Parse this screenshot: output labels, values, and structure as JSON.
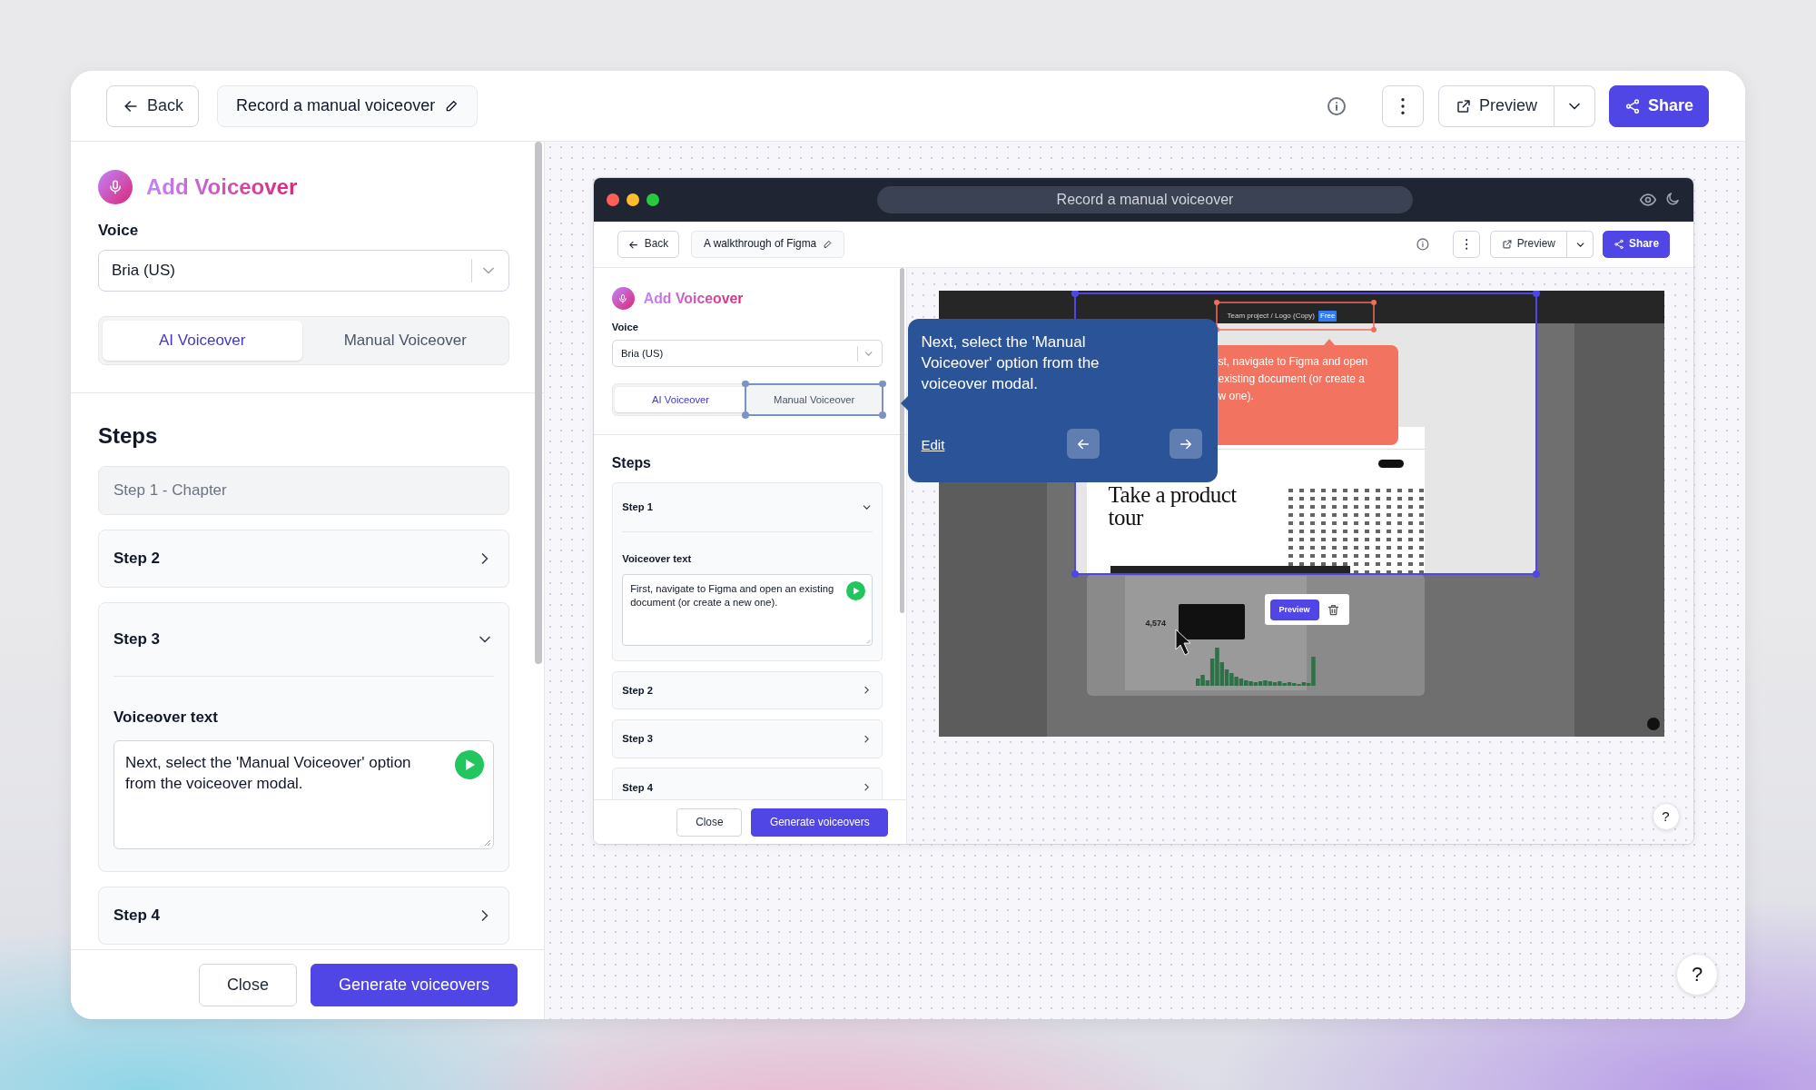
{
  "topbar": {
    "back": "Back",
    "title": "Record a manual voiceover",
    "preview": "Preview",
    "share": "Share"
  },
  "panel": {
    "heading": "Add Voiceover",
    "voice_label": "Voice",
    "voice_value": "Bria (US)",
    "modes": [
      {
        "label": "AI Voiceover",
        "selected": true,
        "highlighted": false
      },
      {
        "label": "Manual Voiceover",
        "selected": false,
        "highlighted": false
      }
    ],
    "steps_heading": "Steps",
    "steps": [
      {
        "kind": "chapter",
        "title": "Step 1 - Chapter"
      },
      {
        "kind": "step",
        "title": "Step 2",
        "expanded": false
      },
      {
        "kind": "step",
        "title": "Step 3",
        "expanded": true,
        "field_label": "Voiceover text",
        "text": "Next, select the 'Manual Voiceover' option from the voiceover modal."
      },
      {
        "kind": "step",
        "title": "Step 4",
        "expanded": false
      }
    ],
    "close": "Close",
    "generate": "Generate voiceovers"
  },
  "preview_window": {
    "title": "Record a manual voiceover",
    "topbar": {
      "back": "Back",
      "title": "A walkthrough of Figma",
      "preview": "Preview",
      "share": "Share"
    },
    "panel": {
      "heading": "Add Voiceover",
      "voice_label": "Voice",
      "voice_value": "Bria (US)",
      "modes": [
        {
          "label": "AI Voiceover",
          "selected": true,
          "highlighted": false
        },
        {
          "label": "Manual Voiceover",
          "selected": false,
          "highlighted": true
        }
      ],
      "steps_heading": "Steps",
      "steps": [
        {
          "kind": "step",
          "title": "Step 1",
          "expanded": true,
          "field_label": "Voiceover text",
          "text": "First, navigate to Figma and open an existing document (or create a new one)."
        },
        {
          "kind": "step",
          "title": "Step 2",
          "expanded": false
        },
        {
          "kind": "step",
          "title": "Step 3",
          "expanded": false
        },
        {
          "kind": "step",
          "title": "Step 4",
          "expanded": false
        }
      ],
      "close": "Close",
      "generate": "Generate voiceovers"
    },
    "tooltip": {
      "text": "Next, select the 'Manual Voiceover' option from the voiceover modal.",
      "link": "Edit"
    },
    "screenshot": {
      "project": "Team project / Logo (Copy)",
      "badge": "Free",
      "callout_lines": [
        "st, navigate to Figma and open",
        "existing document (or create a",
        "w one)."
      ],
      "headline": "Take a product tour",
      "stats_value": "4,574",
      "preview_button": "Preview"
    },
    "help": "?"
  },
  "help": "?"
}
